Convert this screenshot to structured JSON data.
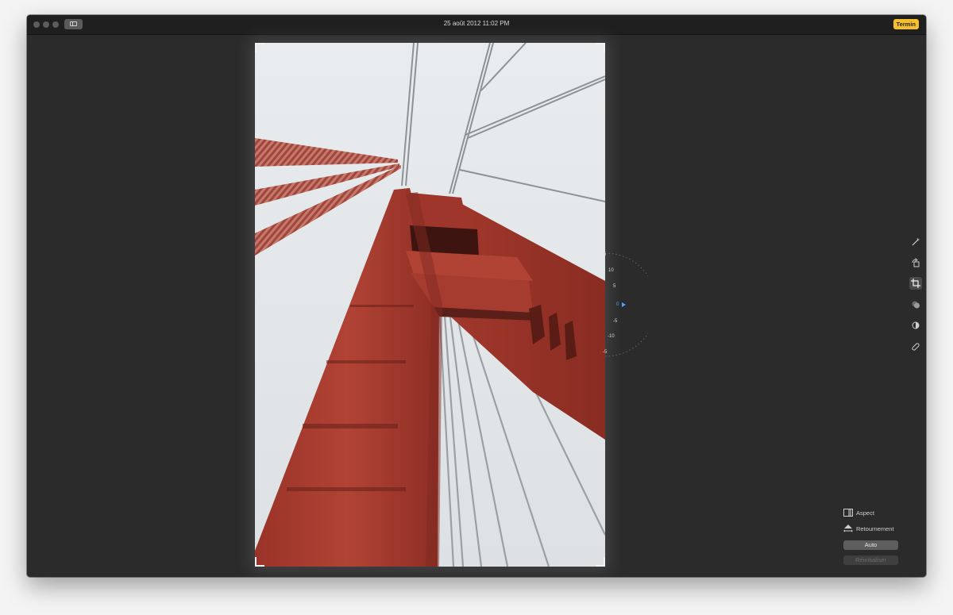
{
  "window": {
    "title": "25 août 2012 11:02 PM",
    "done_label": "Termin"
  },
  "photo": {
    "subject": "Golden Gate Bridge tower seen from below"
  },
  "straighten": {
    "labels": [
      "5",
      "10",
      "5",
      "0",
      "-5",
      "-10",
      "-5"
    ],
    "active_value": "0",
    "accent": "#4aa3ff"
  },
  "tools": [
    {
      "name": "enhance",
      "icon": "magic-wand-icon"
    },
    {
      "name": "rotate",
      "icon": "rotate-icon"
    },
    {
      "name": "crop",
      "icon": "crop-icon",
      "active": true
    },
    {
      "name": "filters",
      "icon": "filters-icon"
    },
    {
      "name": "adjust",
      "icon": "adjust-icon"
    },
    {
      "name": "retouch",
      "icon": "bandage-icon"
    }
  ],
  "crop_panel": {
    "aspect_label": "Aspect",
    "flip_label": "Retournement",
    "auto_label": "Auto",
    "reset_label": "Réinitialiser"
  },
  "colors": {
    "accent_done": "#f5c02a",
    "window_bg": "#2b2b2b",
    "bridge_red": "#a8382c"
  }
}
